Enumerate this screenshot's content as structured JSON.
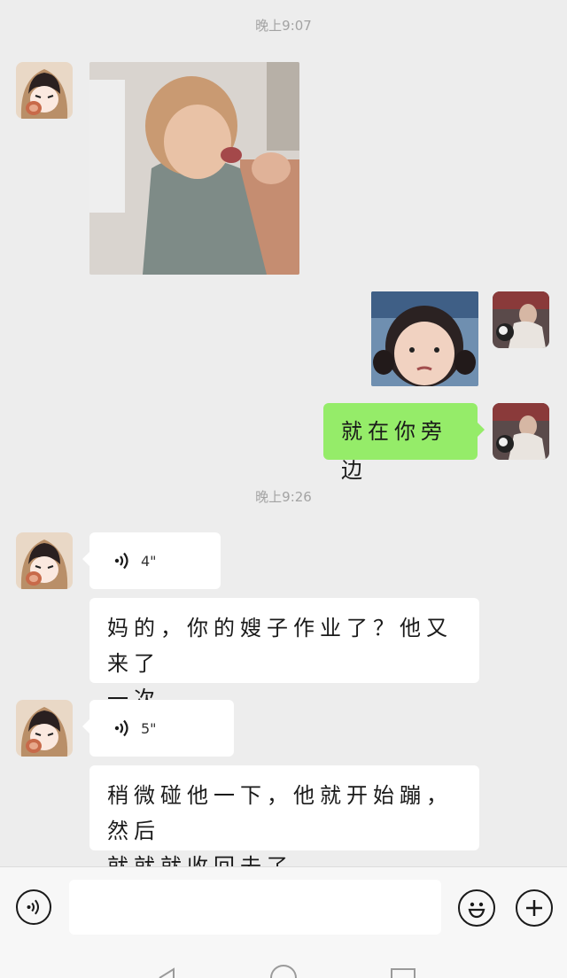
{
  "chat": {
    "timestamps": [
      "晚上9:07",
      "晚上9:26"
    ],
    "messages": [
      {
        "from": "other",
        "type": "image",
        "content": "toddler-laughing-photo"
      },
      {
        "from": "me",
        "type": "sticker",
        "content": "girl-frowning-sticker"
      },
      {
        "from": "me",
        "type": "text",
        "text": "就在你旁边"
      },
      {
        "from": "other",
        "type": "voice",
        "duration": "4\""
      },
      {
        "from": "other",
        "type": "text",
        "text_line1": "妈的，你的嫂子作业了？他又来了",
        "text_line2": "一次。"
      },
      {
        "from": "other",
        "type": "voice",
        "duration": "5\""
      },
      {
        "from": "other",
        "type": "text",
        "text_line1": "稍微碰他一下，他就开始蹦，然后",
        "text_line2": "就就就收回去了。"
      }
    ]
  },
  "input_bar": {
    "voice_button_icon": "voice-icon",
    "emoji_button_icon": "emoji-icon",
    "plus_button_icon": "plus-icon",
    "input_value": ""
  },
  "colors": {
    "background": "#ededed",
    "my_bubble": "#95ec69",
    "other_bubble": "#ffffff",
    "timestamp": "#a3a3a3"
  }
}
